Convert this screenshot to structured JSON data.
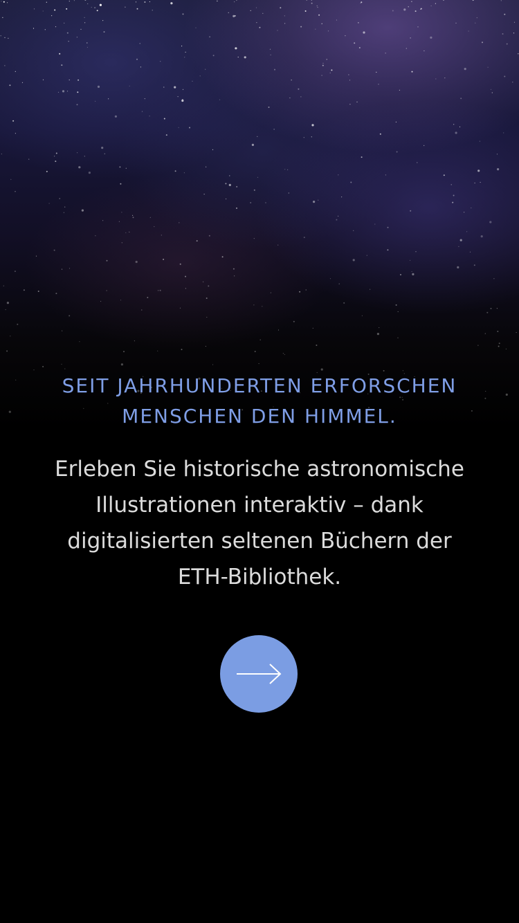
{
  "intro": {
    "headline": "SEIT JAHRHUNDERTEN ERFORSCHEN\nMENSCHEN DEN HIMMEL.",
    "description": "Erleben Sie historische astronomische\nIllustrationen interaktiv – dank\ndigitalisierten seltenen Büchern der\nETH-Bibliothek."
  },
  "next_button": {
    "icon": "arrow-right-icon"
  },
  "colors": {
    "accent": "#7b9de3",
    "headline": "#7f9ee6",
    "body_text": "#dcdcdc",
    "background": "#000000"
  }
}
